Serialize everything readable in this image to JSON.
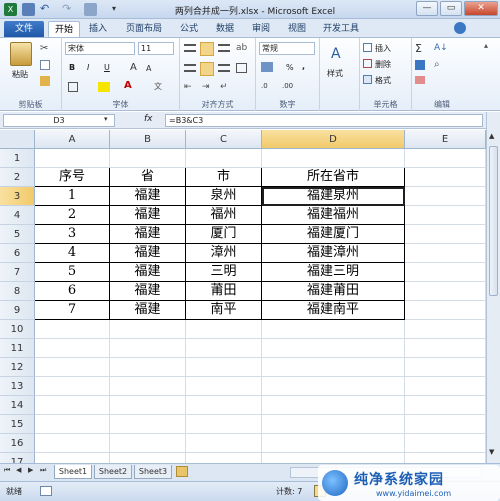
{
  "window": {
    "title": "两列合并成一列.xlsx - Microsoft Excel",
    "minimize": "—",
    "restore": "▭",
    "close": "✕"
  },
  "ribbon_tabs": [
    "文件",
    "开始",
    "插入",
    "页面布局",
    "公式",
    "数据",
    "审阅",
    "视图",
    "开发工具"
  ],
  "ribbon": {
    "paste_label": "粘贴",
    "font_name": "宋体",
    "font_size": "11",
    "number_format": "常规",
    "style_label": "样式",
    "insert_label": "插入",
    "delete_label": "删除",
    "format_label": "格式",
    "bold": "B",
    "italic": "I",
    "underline": "U",
    "percent": "%",
    "comma": ",",
    "groups": {
      "clipboard": "剪贴板",
      "font": "字体",
      "alignment": "对齐方式",
      "number": "数字",
      "cells": "单元格",
      "editing": "编辑"
    }
  },
  "formula_bar": {
    "name_box": "D3",
    "fx": "fx",
    "formula": "=B3&C3"
  },
  "columns": [
    "A",
    "B",
    "C",
    "D",
    "E"
  ],
  "rows": [
    "1",
    "2",
    "3",
    "4",
    "5",
    "6",
    "7",
    "8",
    "9",
    "10",
    "11",
    "12",
    "13",
    "14",
    "15",
    "16",
    "17"
  ],
  "selected_cell": "D3",
  "table": {
    "headers": [
      "序号",
      "省",
      "市",
      "所在省市"
    ],
    "rows": [
      [
        "1",
        "福建",
        "泉州",
        "福建泉州"
      ],
      [
        "2",
        "福建",
        "福州",
        "福建福州"
      ],
      [
        "3",
        "福建",
        "厦门",
        "福建厦门"
      ],
      [
        "4",
        "福建",
        "漳州",
        "福建漳州"
      ],
      [
        "5",
        "福建",
        "三明",
        "福建三明"
      ],
      [
        "6",
        "福建",
        "莆田",
        "福建莆田"
      ],
      [
        "7",
        "福建",
        "南平",
        "福建南平"
      ]
    ]
  },
  "sheets": [
    "Sheet1",
    "Sheet2",
    "Sheet3"
  ],
  "status": {
    "ready": "就绪",
    "count": "计数: 7"
  },
  "watermark": {
    "title": "纯净系统家园",
    "url": "www.yidaimei.com"
  },
  "colors": {
    "file_tab": "#2a66b8",
    "selection_header": "#f1c96a",
    "ribbon_bg": "#e5eef9"
  }
}
